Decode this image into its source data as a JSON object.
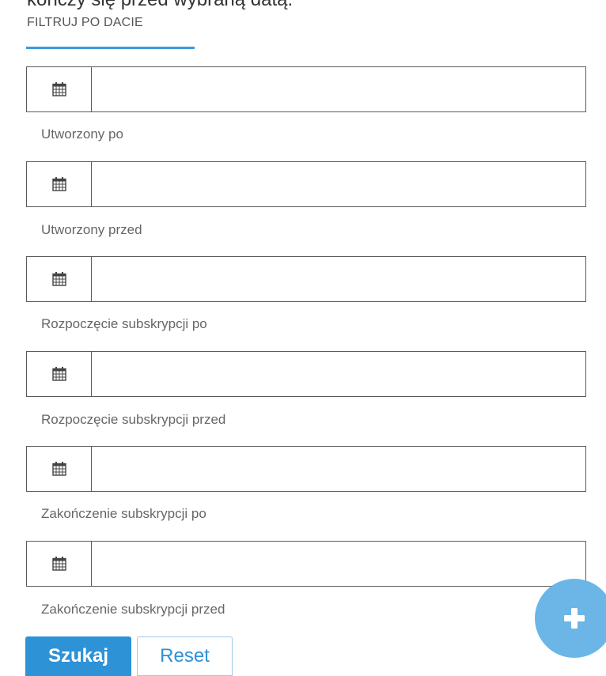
{
  "heading_clipped": "kończy się przed wybraną datą.",
  "section": {
    "title": "FILTRUJ PO DACIE"
  },
  "fields": [
    {
      "label": "Utworzony po",
      "value": "",
      "icon": "calendar-icon"
    },
    {
      "label": "Utworzony przed",
      "value": "",
      "icon": "calendar-icon"
    },
    {
      "label": "Rozpoczęcie subskrypcji po",
      "value": "",
      "icon": "calendar-icon"
    },
    {
      "label": "Rozpoczęcie subskrypcji przed",
      "value": "",
      "icon": "calendar-icon"
    },
    {
      "label": "Zakończenie subskrypcji po",
      "value": "",
      "icon": "calendar-icon"
    },
    {
      "label": "Zakończenie subskrypcji przed",
      "value": "",
      "icon": "calendar-icon"
    }
  ],
  "buttons": {
    "search_label": "Szukaj",
    "reset_label": "Reset"
  },
  "fab": {
    "icon": "plus-icon"
  },
  "colors": {
    "accent": "#2e92d6",
    "underline": "#3d9bdc",
    "fab": "#6bb6e6",
    "border": "#5a5a5a"
  }
}
